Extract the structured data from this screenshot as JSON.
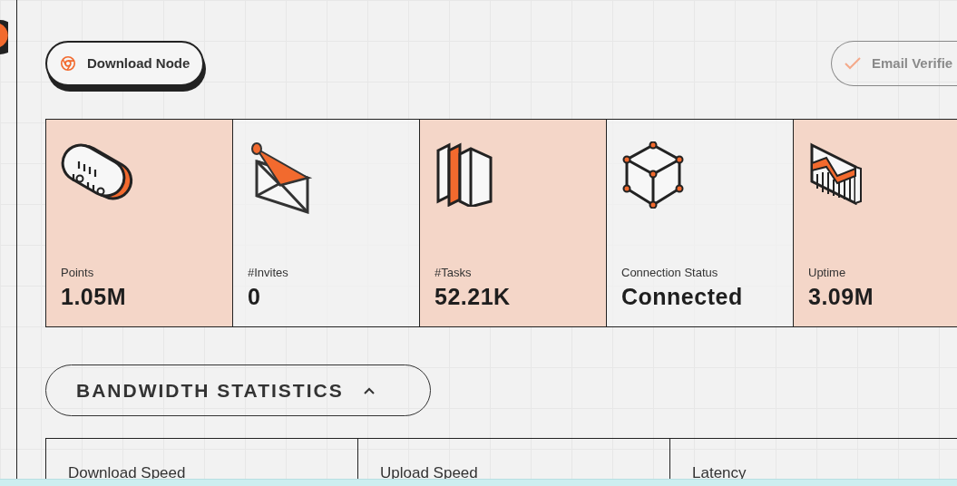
{
  "actions": [
    {
      "kind": "download",
      "label": "Download Node",
      "disabled": false
    },
    {
      "kind": "verified",
      "label": "Email Verifie",
      "disabled": true
    }
  ],
  "stats": [
    {
      "kind": "binary",
      "label": "Points",
      "value": "1.05M",
      "highlighted": true
    },
    {
      "kind": "envelope",
      "label": "#Invites",
      "value": "0",
      "highlighted": false
    },
    {
      "kind": "books",
      "label": "#Tasks",
      "value": "52.21K",
      "highlighted": true
    },
    {
      "kind": "cube",
      "label": "Connection Status",
      "value": "Connected",
      "highlighted": false
    },
    {
      "kind": "chart",
      "label": "Uptime",
      "value": "3.09M",
      "highlighted": true
    }
  ],
  "bandwidth": {
    "title": "BANDWIDTH STATISTICS",
    "expanded": true,
    "columns": [
      "Download Speed",
      "Upload Speed",
      "Latency"
    ]
  }
}
